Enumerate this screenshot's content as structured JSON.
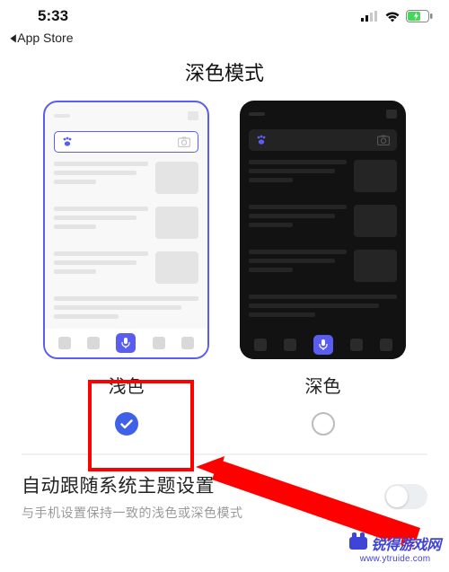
{
  "status": {
    "time": "5:33"
  },
  "breadcrumb": {
    "label": "App Store"
  },
  "page_title": "深色模式",
  "options": {
    "light": {
      "label": "浅色",
      "selected": true
    },
    "dark": {
      "label": "深色",
      "selected": false
    }
  },
  "auto_follow": {
    "title": "自动跟随系统主题设置",
    "subtitle": "与手机设置保持一致的浅色或深色模式",
    "enabled": false
  },
  "watermark": {
    "title": "锐得游戏网",
    "url": "www.ytruide.com"
  },
  "colors": {
    "accent": "#5a5ef0",
    "check": "#4060e8",
    "annotation": "#ff0000"
  }
}
